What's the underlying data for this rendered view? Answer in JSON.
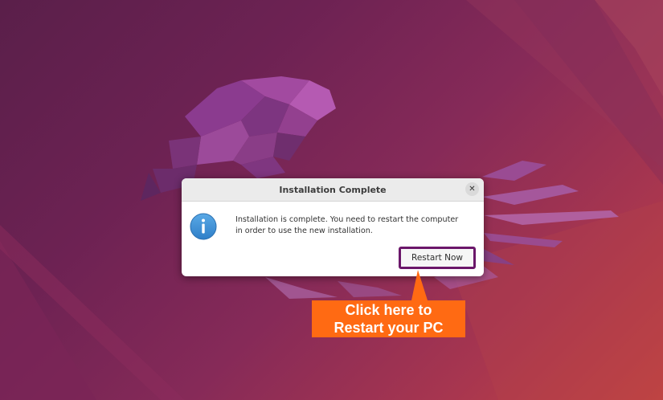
{
  "dialog": {
    "title": "Installation Complete",
    "message_line1": "Installation is complete. You need to restart the computer",
    "message_line2": "in order to use the new installation.",
    "restart_label": "Restart Now",
    "close_symbol": "✕",
    "info_icon": "info-icon",
    "close_icon": "close-icon"
  },
  "annotation": {
    "line1": "Click here to",
    "line2": "Restart your PC",
    "color": "#ff6a13",
    "highlight_color": "#6b176a"
  }
}
